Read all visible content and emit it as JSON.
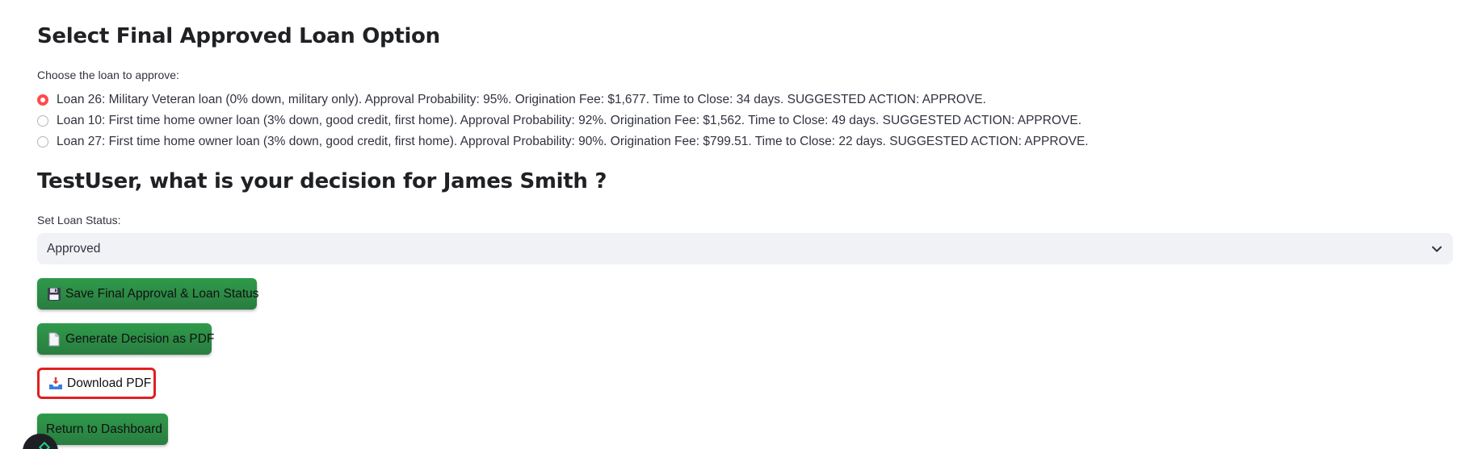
{
  "loan_option": {
    "title": "Select Final Approved Loan Option",
    "radio_label": "Choose the loan to approve:",
    "options": [
      {
        "label": "Loan 26: Military Veteran loan (0% down, military only). Approval Probability: 95%. Origination Fee: $1,677. Time to Close: 34 days. SUGGESTED ACTION: APPROVE.",
        "selected": true
      },
      {
        "label": "Loan 10: First time home owner loan (3% down, good credit, first home). Approval Probability: 92%. Origination Fee: $1,562. Time to Close: 49 days. SUGGESTED ACTION: APPROVE.",
        "selected": false
      },
      {
        "label": "Loan 27: First time home owner loan (3% down, good credit, first home). Approval Probability: 90%. Origination Fee: $799.51. Time to Close: 22 days. SUGGESTED ACTION: APPROVE.",
        "selected": false
      }
    ]
  },
  "decision": {
    "title": "TestUser, what is your decision for James Smith ?",
    "status_label": "Set Loan Status:",
    "status_value": "Approved"
  },
  "buttons": {
    "save": {
      "label": "Save Final Approval & Loan Status",
      "icon": "floppy-disk-icon"
    },
    "generate": {
      "label": "Generate Decision as PDF",
      "icon": "document-icon"
    },
    "download": {
      "label": "Download PDF",
      "icon": "inbox-tray-icon"
    },
    "return": {
      "label": "Return to Dashboard"
    }
  },
  "colors": {
    "radio_selected": "#ff4b4b",
    "button_green": "#2e8b45",
    "highlight_border": "#e02020",
    "select_background": "#f0f2f6"
  }
}
